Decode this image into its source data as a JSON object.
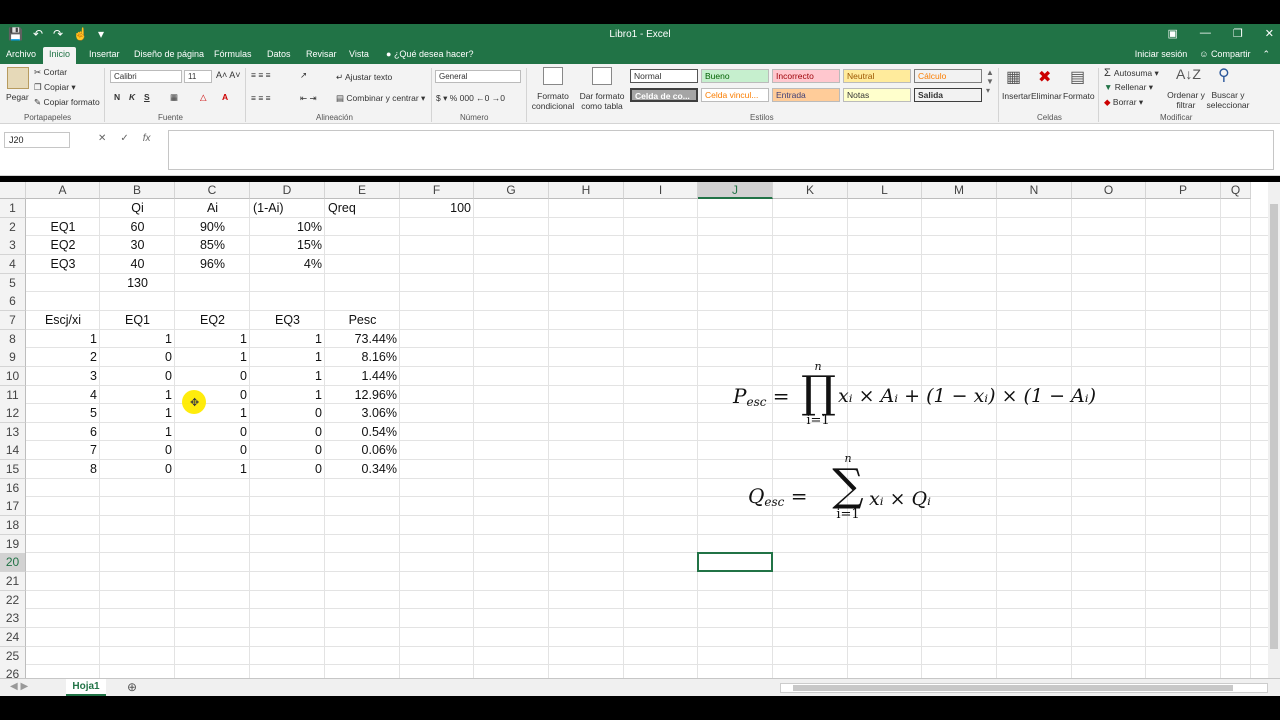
{
  "window": {
    "title": "Libro1 - Excel"
  },
  "ribbon_tabs": [
    {
      "label": "Archivo"
    },
    {
      "label": "Inicio"
    },
    {
      "label": "Insertar"
    },
    {
      "label": "Diseño de página"
    },
    {
      "label": "Fórmulas"
    },
    {
      "label": "Datos"
    },
    {
      "label": "Revisar"
    },
    {
      "label": "Vista"
    },
    {
      "label": "¿Qué desea hacer?"
    }
  ],
  "account": {
    "signin": "Iniciar sesión",
    "share": "Compartir"
  },
  "clipboard": {
    "paste": "Pegar",
    "cut": "Cortar",
    "copy": "Copiar",
    "format_painter": "Copiar formato",
    "group": "Portapapeles"
  },
  "font": {
    "name": "Calibri",
    "size": "11",
    "bold": "N",
    "italic": "K",
    "underline": "S",
    "group": "Fuente"
  },
  "alignment": {
    "wrap": "Ajustar texto",
    "merge": "Combinar y centrar",
    "group": "Alineación"
  },
  "number": {
    "format": "General",
    "group": "Número"
  },
  "styles": {
    "cond_format": "Formato condicional",
    "as_table": "Dar formato como tabla",
    "items": [
      "Normal",
      "Bueno",
      "Incorrecto",
      "Neutral",
      "Cálculo",
      "Celda de co...",
      "Celda vincul...",
      "Entrada",
      "Notas",
      "Salida"
    ],
    "group": "Estilos"
  },
  "cells_group": {
    "insert": "Insertar",
    "delete": "Eliminar",
    "format": "Formato",
    "group": "Celdas"
  },
  "editing": {
    "autosum": "Autosuma",
    "fill": "Rellenar",
    "clear": "Borrar",
    "sort": "Ordenar y filtrar",
    "find": "Buscar y seleccionar",
    "group": "Modificar"
  },
  "formula_bar": {
    "name_box": "J20",
    "content": ""
  },
  "columns": [
    "A",
    "B",
    "C",
    "D",
    "E",
    "F",
    "G",
    "H",
    "I",
    "J",
    "K",
    "L",
    "M",
    "N",
    "O",
    "P",
    "Q"
  ],
  "rows": [
    "1",
    "2",
    "3",
    "4",
    "5",
    "6",
    "7",
    "8",
    "9",
    "10",
    "11",
    "12",
    "13",
    "14",
    "15",
    "16",
    "17",
    "18",
    "19",
    "20",
    "21",
    "22",
    "23",
    "24",
    "25",
    "26"
  ],
  "cells": {
    "B1": "Qi",
    "C1": "Ai",
    "D1": "(1-Ai)",
    "E1": "Qreq",
    "F1": "100",
    "A2": "EQ1",
    "B2": "60",
    "C2": "90%",
    "D2": "10%",
    "A3": "EQ2",
    "B3": "30",
    "C3": "85%",
    "D3": "15%",
    "A4": "EQ3",
    "B4": "40",
    "C4": "96%",
    "D4": "4%",
    "B5": "130",
    "A7": "Escj/xi",
    "B7": "EQ1",
    "C7": "EQ2",
    "D7": "EQ3",
    "E7": "Pesc",
    "A8": "1",
    "B8": "1",
    "C8": "1",
    "D8": "1",
    "E8": "73.44%",
    "A9": "2",
    "B9": "0",
    "C9": "1",
    "D9": "1",
    "E9": "8.16%",
    "A10": "3",
    "B10": "0",
    "C10": "0",
    "D10": "1",
    "E10": "1.44%",
    "A11": "4",
    "B11": "1",
    "C11": "0",
    "D11": "1",
    "E11": "12.96%",
    "A12": "5",
    "B12": "1",
    "C12": "1",
    "D12": "0",
    "E12": "3.06%",
    "A13": "6",
    "B13": "1",
    "C13": "0",
    "D13": "0",
    "E13": "0.54%",
    "A14": "7",
    "B14": "0",
    "C14": "0",
    "D14": "0",
    "E14": "0.06%",
    "A15": "8",
    "B15": "0",
    "C15": "1",
    "D15": "0",
    "E15": "0.34%"
  },
  "selected_cell": "J20",
  "sheet_tabs": [
    {
      "label": "Hoja1"
    }
  ],
  "formulas": {
    "p_lhs": "P",
    "p_sub": "esc",
    "p_upper": "n",
    "p_lower": "i=1",
    "p_rhs": "xᵢ × Aᵢ + (1 − xᵢ) × (1 − Aᵢ)",
    "q_lhs": "Q",
    "q_sub": "esc",
    "q_upper": "n",
    "q_lower": "i=1",
    "q_rhs": "xᵢ × Qᵢ"
  }
}
